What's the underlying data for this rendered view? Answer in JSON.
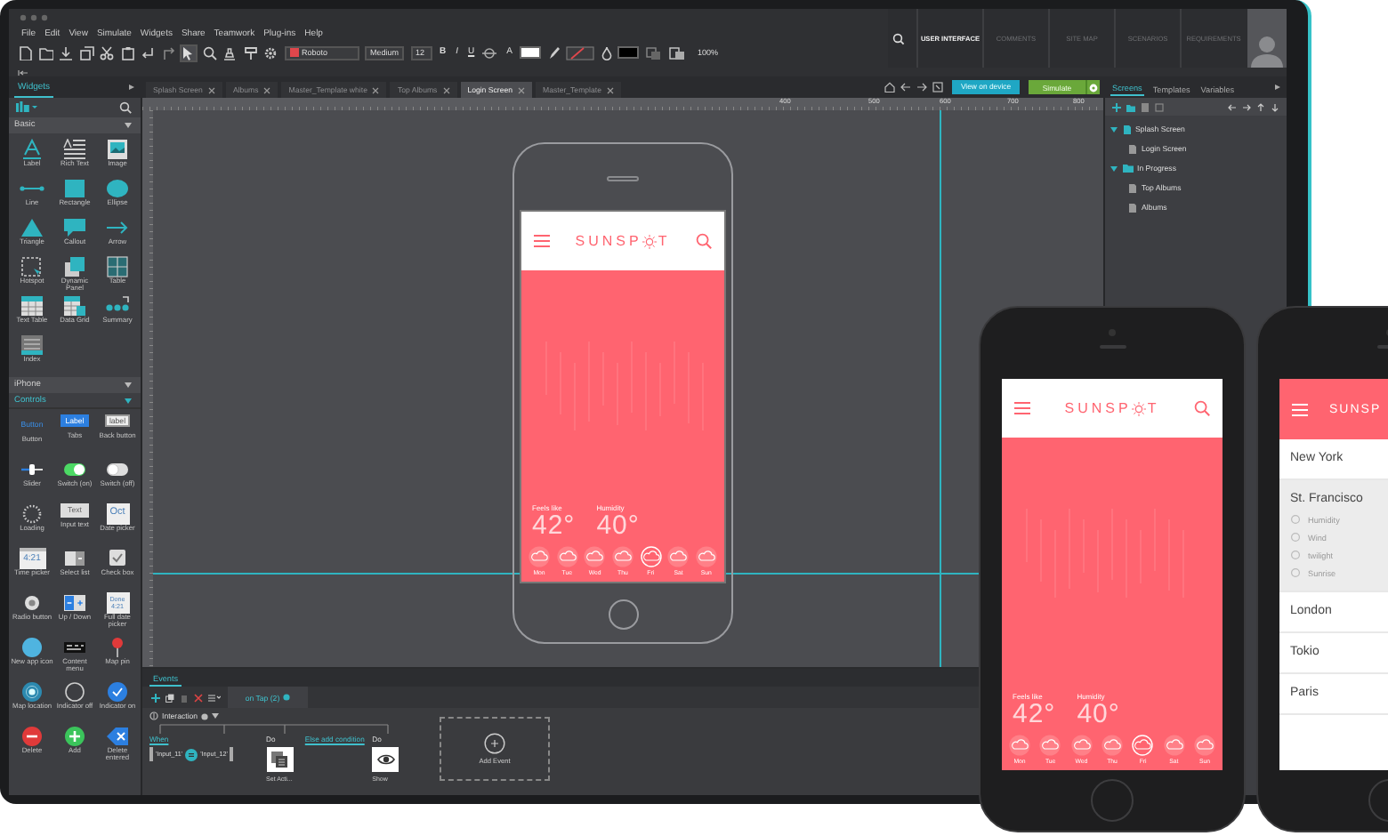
{
  "menu": [
    "File",
    "Edit",
    "View",
    "Simulate",
    "Widgets",
    "Share",
    "Teamwork",
    "Plug-ins",
    "Help"
  ],
  "toolbar": {
    "font": "Roboto",
    "weight": "Medium",
    "size": "12",
    "styles": [
      "B",
      "I",
      "U"
    ],
    "text_color": "A",
    "zoom": "100%"
  },
  "mode_tabs": [
    {
      "label": "USER INTERFACE",
      "selected": true
    },
    {
      "label": "COMMENTS",
      "selected": false
    },
    {
      "label": "SITE MAP",
      "selected": false
    },
    {
      "label": "SCENARIOS",
      "selected": false
    },
    {
      "label": "REQUIREMENTS",
      "selected": false
    }
  ],
  "widgets_panel": {
    "title": "Widgets",
    "libraries": [
      {
        "title": "Basic",
        "items": [
          {
            "label": "Label"
          },
          {
            "label": "Rich Text"
          },
          {
            "label": "Image"
          },
          {
            "label": "Line"
          },
          {
            "label": "Rectangle"
          },
          {
            "label": "Ellipse"
          },
          {
            "label": "Triangle"
          },
          {
            "label": "Callout"
          },
          {
            "label": "Arrow"
          },
          {
            "label": "Hotspot"
          },
          {
            "label": "Dynamic Panel"
          },
          {
            "label": "Table"
          },
          {
            "label": "Text Table"
          },
          {
            "label": "Data Grid"
          },
          {
            "label": "Summary"
          },
          {
            "label": "Index"
          }
        ]
      },
      {
        "title": "iPhone",
        "groups": [
          {
            "title": "Controls",
            "items": [
              {
                "label": "Button",
                "preview": "Button"
              },
              {
                "label": "Tabs",
                "preview": "Label"
              },
              {
                "label": "Back button",
                "preview": "label"
              },
              {
                "label": "Slider"
              },
              {
                "label": "Switch (on)"
              },
              {
                "label": "Switch (off)"
              },
              {
                "label": "Loading"
              },
              {
                "label": "Input text",
                "preview": "Text"
              },
              {
                "label": "Date picker",
                "preview": "Oct"
              },
              {
                "label": "Time picker",
                "preview": "4:21"
              },
              {
                "label": "Select list"
              },
              {
                "label": "Check box"
              },
              {
                "label": "Radio button"
              },
              {
                "label": "Up / Down"
              },
              {
                "label": "Full date picker",
                "preview": "Done 4:21"
              },
              {
                "label": "New app icon"
              },
              {
                "label": "Content menu"
              },
              {
                "label": "Map pin"
              },
              {
                "label": "Map location"
              },
              {
                "label": "Indicator off"
              },
              {
                "label": "Indicator on"
              },
              {
                "label": "Delete"
              },
              {
                "label": "Add"
              },
              {
                "label": "Delete entered"
              }
            ]
          }
        ]
      }
    ]
  },
  "doc_tabs": [
    {
      "label": "Splash Screen",
      "selected": false
    },
    {
      "label": "Albums",
      "selected": false
    },
    {
      "label": "Master_Template white",
      "selected": false
    },
    {
      "label": "Top Albums",
      "selected": false
    },
    {
      "label": "Login Screen",
      "selected": true
    },
    {
      "label": "Master_Template",
      "selected": false
    }
  ],
  "actions": {
    "view": "View on device",
    "simulate": "Simulate"
  },
  "ruler": [
    "400",
    "500",
    "600",
    "700",
    "800"
  ],
  "canvas_mockup": {
    "kind": "weather",
    "logo": [
      "SUNSP",
      "T"
    ],
    "stats": [
      {
        "label": "Feels like",
        "value": "42°"
      },
      {
        "label": "Humidity",
        "value": "40°"
      }
    ],
    "days": [
      {
        "label": "Mon",
        "selected": false
      },
      {
        "label": "Tue",
        "selected": false
      },
      {
        "label": "Wed",
        "selected": false
      },
      {
        "label": "Thu",
        "selected": false
      },
      {
        "label": "Fri",
        "selected": true
      },
      {
        "label": "Sat",
        "selected": false
      },
      {
        "label": "Sun",
        "selected": false
      }
    ]
  },
  "events": {
    "title": "Events",
    "case": "on Tap (2)",
    "interaction": "Interaction",
    "when": "When",
    "do": [
      "Do",
      "Do"
    ],
    "else": "Else add condition",
    "inputs": [
      "'Input_11'",
      "'Input_12'"
    ],
    "actions": [
      "Set Acti...",
      "Show"
    ],
    "add": "Add Event"
  },
  "screens_panel": {
    "tabs": [
      {
        "label": "Screens",
        "selected": true
      },
      {
        "label": "Templates",
        "selected": false
      },
      {
        "label": "Variables",
        "selected": false
      }
    ],
    "tree": [
      {
        "label": "Splash Screen",
        "expanded": true,
        "children": [
          {
            "label": "Login Screen"
          }
        ]
      },
      {
        "label": "In Progress",
        "expanded": true,
        "children": [
          {
            "label": "Top Albums"
          },
          {
            "label": "Albums"
          }
        ]
      }
    ]
  },
  "devices": [
    {
      "kind": "weather",
      "logo": [
        "SUNSP",
        "T"
      ],
      "stats": [
        {
          "label": "Feels like",
          "value": "42°"
        },
        {
          "label": "Humidity",
          "value": "40°"
        }
      ],
      "days": [
        {
          "label": "Mon",
          "selected": false
        },
        {
          "label": "Tue",
          "selected": false
        },
        {
          "label": "Wed",
          "selected": false
        },
        {
          "label": "Thu",
          "selected": false
        },
        {
          "label": "Fri",
          "selected": true
        },
        {
          "label": "Sat",
          "selected": false
        },
        {
          "label": "Sun",
          "selected": false
        }
      ]
    },
    {
      "kind": "cities",
      "logo": [
        "SUNSP"
      ],
      "cities": [
        {
          "name": "New York",
          "selected": false
        },
        {
          "name": "St. Francisco",
          "selected": true,
          "details": [
            "Humidity",
            "Wind",
            "twilight",
            "Sunrise"
          ]
        },
        {
          "name": "London",
          "selected": false
        },
        {
          "name": "Tokio",
          "selected": false
        },
        {
          "name": "Paris",
          "selected": false
        }
      ]
    }
  ]
}
